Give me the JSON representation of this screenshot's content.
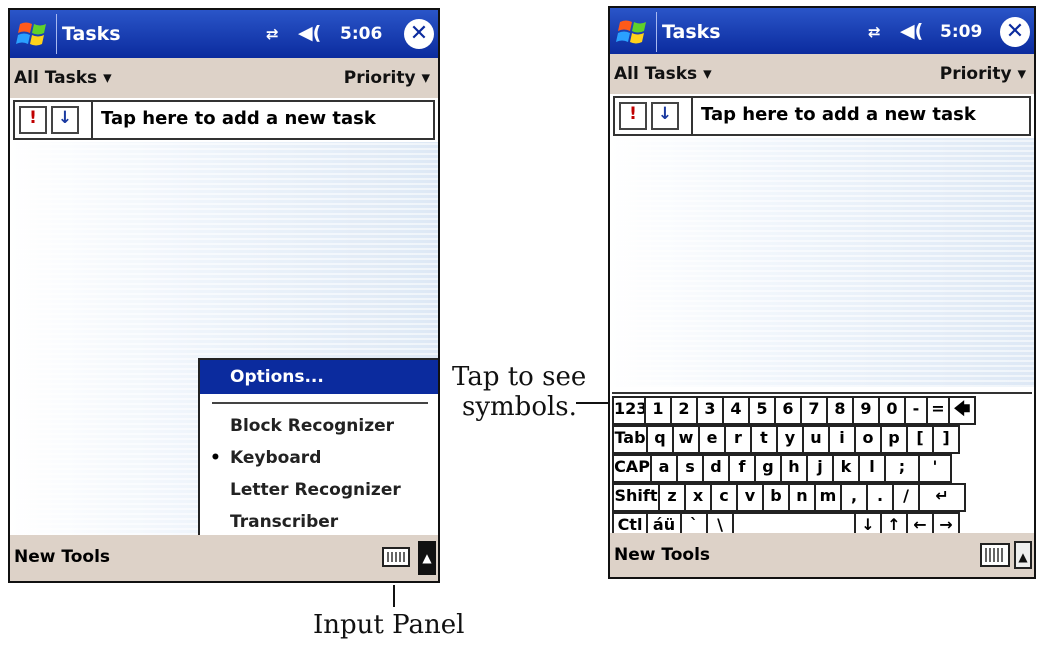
{
  "app_title": "Tasks",
  "left_screen": {
    "clock": "5:06",
    "filter": "All Tasks",
    "sort": "Priority",
    "priority_btn": "!",
    "sort_btn": "↓",
    "new_task_prompt": "Tap here to add a new task",
    "menu_bar": "New Tools",
    "input_menu": {
      "options": "Options...",
      "items": [
        "Block Recognizer",
        "Keyboard",
        "Letter Recognizer",
        "Transcriber"
      ],
      "selected_bullet": "•"
    }
  },
  "right_screen": {
    "clock": "5:09",
    "filter": "All Tasks",
    "sort": "Priority",
    "priority_btn": "!",
    "sort_btn": "↓",
    "new_task_prompt": "Tap here to add a new task",
    "menu_bar": "New Tools",
    "keyboard": {
      "row1": [
        "123",
        "1",
        "2",
        "3",
        "4",
        "5",
        "6",
        "7",
        "8",
        "9",
        "0",
        "-",
        "=",
        "🡄"
      ],
      "row2": [
        "Tab",
        "q",
        "w",
        "e",
        "r",
        "t",
        "y",
        "u",
        "i",
        "o",
        "p",
        "[",
        "]"
      ],
      "row3": [
        "CAP",
        "a",
        "s",
        "d",
        "f",
        "g",
        "h",
        "j",
        "k",
        "l",
        ";",
        "'"
      ],
      "row4": [
        "Shift",
        "z",
        "x",
        "c",
        "v",
        "b",
        "n",
        "m",
        ",",
        ".",
        "/",
        "↵"
      ],
      "row5": [
        "Ctl",
        "áü",
        "`",
        "\\",
        "",
        "↓",
        "↑",
        "←",
        "→"
      ]
    }
  },
  "annotations": {
    "input_panel": "Input Panel",
    "tap_symbols_line1": "Tap to see",
    "tap_symbols_line2": "symbols."
  },
  "icons": [
    "windows-start-icon",
    "connectivity-icon",
    "volume-icon",
    "close-icon",
    "keyboard-icon",
    "sip-arrow-icon"
  ],
  "colors": {
    "titlebar": "#0b2b9e",
    "bars": "#ddd2c8"
  }
}
